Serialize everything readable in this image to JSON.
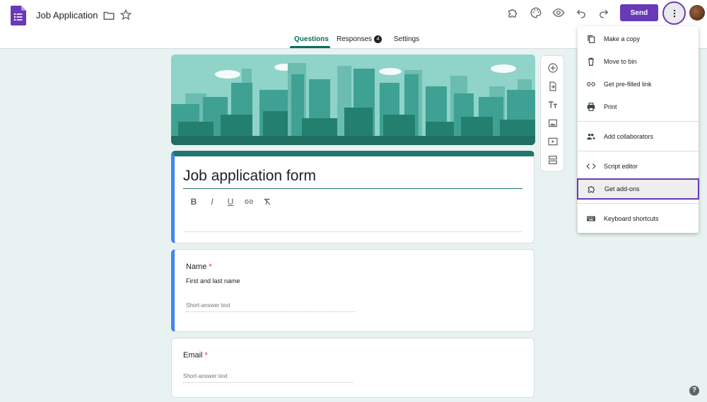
{
  "header": {
    "doc_title": "Job Application",
    "send_label": "Send",
    "app_color": "#673ab7",
    "icons": [
      "forms-logo-icon",
      "folder-icon",
      "star-icon",
      "addon-puzzle-icon",
      "palette-icon",
      "preview-eye-icon",
      "undo-icon",
      "redo-icon",
      "more-vert-icon"
    ]
  },
  "tabs": [
    {
      "label": "Questions",
      "active": true
    },
    {
      "label": "Responses",
      "badge": "4"
    },
    {
      "label": "Settings"
    }
  ],
  "form": {
    "title": "Job application form",
    "theme_color": "#23766b",
    "format_buttons": [
      "B",
      "I",
      "U",
      "link",
      "clear"
    ]
  },
  "questions": [
    {
      "title": "Name",
      "required_mark": "*",
      "description": "First and last name",
      "placeholder": "Short-answer text"
    },
    {
      "title": "Email",
      "required_mark": "*",
      "placeholder": "Short-answer text"
    }
  ],
  "menu": {
    "items": [
      {
        "label": "Make a copy",
        "icon": "copy-icon"
      },
      {
        "label": "Move to bin",
        "icon": "trash-icon"
      },
      {
        "label": "Get pre-filled link",
        "icon": "link-icon"
      },
      {
        "label": "Print",
        "icon": "print-icon"
      },
      {
        "label": "Add collaborators",
        "icon": "add-person-icon"
      },
      {
        "label": "Script editor",
        "icon": "code-icon"
      },
      {
        "label": "Get add-ons",
        "icon": "puzzle-icon",
        "highlighted": true
      },
      {
        "label": "Keyboard shortcuts",
        "icon": "keyboard-icon"
      }
    ]
  },
  "side_tools": [
    "add-question-icon",
    "import-questions-icon",
    "add-title-icon",
    "add-image-icon",
    "add-video-icon",
    "add-section-icon"
  ],
  "help": "?"
}
